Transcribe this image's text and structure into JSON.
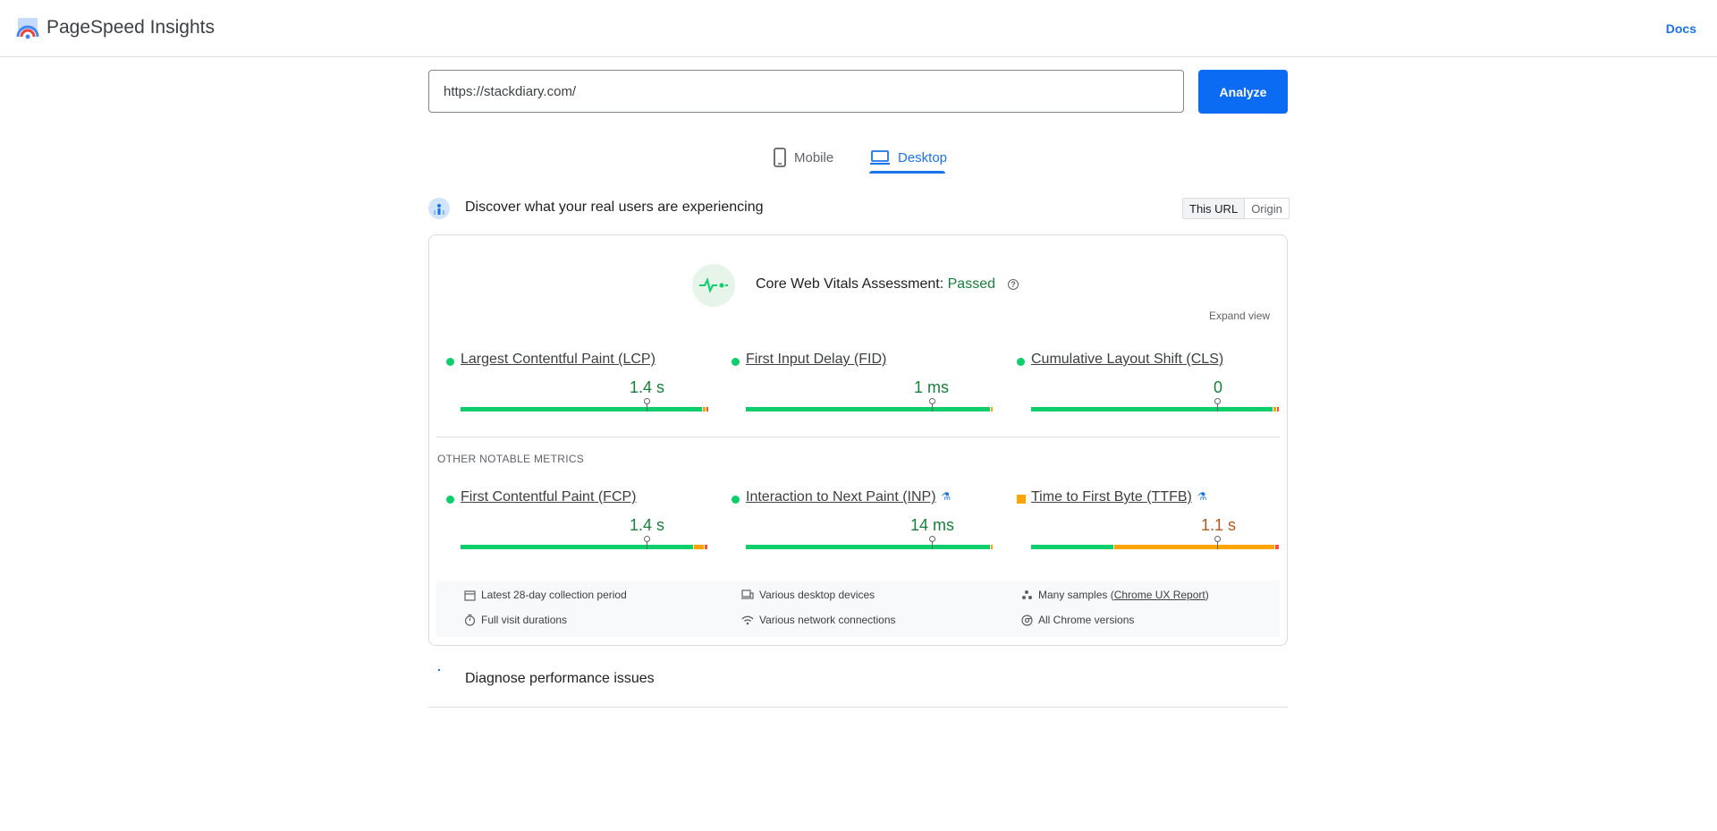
{
  "header": {
    "title": "PageSpeed Insights",
    "docs_label": "Docs"
  },
  "search": {
    "url_value": "https://stackdiary.com/",
    "analyze_label": "Analyze"
  },
  "tabs": {
    "mobile": "Mobile",
    "desktop": "Desktop",
    "active": "Desktop"
  },
  "discover": {
    "title": "Discover what your real users are experiencing",
    "scope_this_url": "This URL",
    "scope_origin": "Origin"
  },
  "assessment": {
    "prefix": "Core Web Vitals Assessment:",
    "status": "Passed",
    "expand_label": "Expand view"
  },
  "core_metrics": [
    {
      "name": "Largest Contentful Paint (LCP)",
      "value": "1.4 s",
      "rating": "good"
    },
    {
      "name": "First Input Delay (FID)",
      "value": "1 ms",
      "rating": "good"
    },
    {
      "name": "Cumulative Layout Shift (CLS)",
      "value": "0",
      "rating": "good"
    }
  ],
  "other_metrics_title": "OTHER NOTABLE METRICS",
  "other_metrics": [
    {
      "name": "First Contentful Paint (FCP)",
      "value": "1.4 s",
      "rating": "good"
    },
    {
      "name": "Interaction to Next Paint (INP)",
      "value": "14 ms",
      "rating": "good",
      "experimental": true
    },
    {
      "name": "Time to First Byte (TTFB)",
      "value": "1.1 s",
      "rating": "needs-improvement",
      "experimental": true
    }
  ],
  "info": {
    "period": "Latest 28-day collection period",
    "devices": "Various desktop devices",
    "samples_prefix": "Many samples (",
    "samples_link": "Chrome UX Report",
    "samples_suffix": ")",
    "durations": "Full visit durations",
    "network": "Various network connections",
    "chrome": "All Chrome versions"
  },
  "diagnose": {
    "title": "Diagnose performance issues"
  },
  "colors": {
    "accent": "#1a73e8",
    "analyze_button": "#0b6bf2",
    "good": "#0cce6b",
    "average": "#ffa400",
    "poor": "#ff4e42",
    "passed_text": "#188038"
  }
}
